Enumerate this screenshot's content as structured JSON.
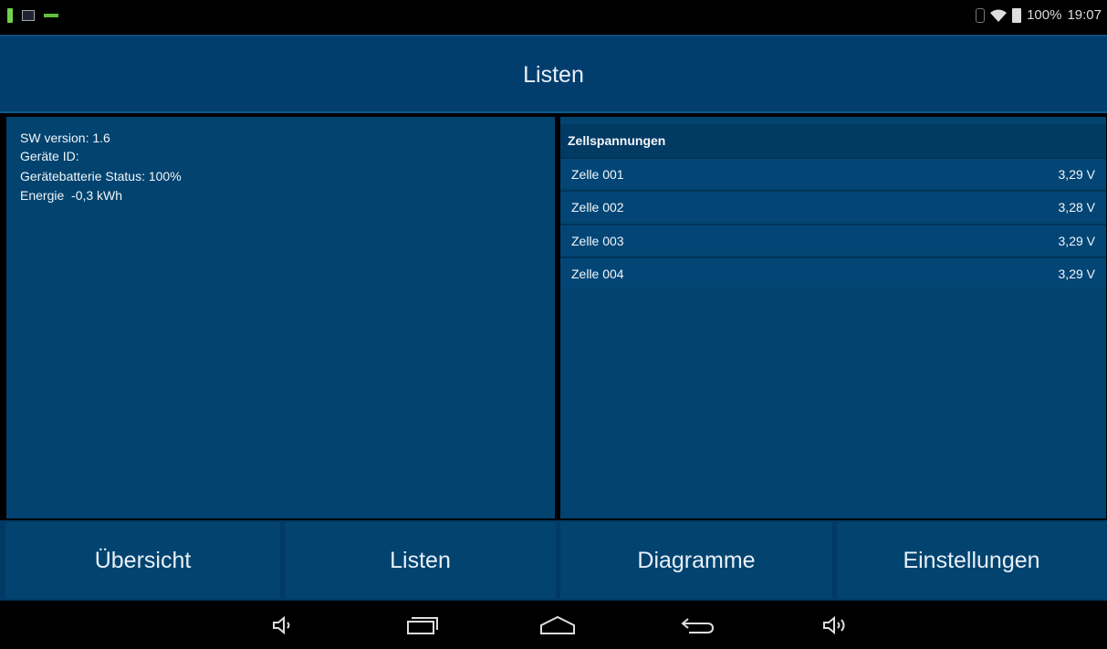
{
  "status_bar": {
    "battery_percent": "100%",
    "time": "19:07"
  },
  "header": {
    "title": "Listen"
  },
  "info": {
    "sw_version": "SW version: 1.6",
    "device_id": "Geräte ID:",
    "battery_status": "Gerätebatterie Status: 100%",
    "energy": "Energie  -0,3 kWh"
  },
  "cell_list": {
    "header": "Zellspannungen",
    "rows": [
      {
        "label": "Zelle 001",
        "value": "3,29 V"
      },
      {
        "label": "Zelle 002",
        "value": "3,28 V"
      },
      {
        "label": "Zelle 003",
        "value": "3,29 V"
      },
      {
        "label": "Zelle 004",
        "value": "3,29 V"
      }
    ]
  },
  "tabs": [
    {
      "label": "Übersicht"
    },
    {
      "label": "Listen"
    },
    {
      "label": "Diagramme"
    },
    {
      "label": "Einstellungen"
    }
  ],
  "navbar": {
    "icons": [
      "volume-down-icon",
      "recent-apps-icon",
      "home-icon",
      "back-icon",
      "volume-up-icon"
    ]
  },
  "colors": {
    "panel_bg": "#02436f",
    "header_bg": "#013e6e",
    "accent_green": "#6fd24a"
  }
}
